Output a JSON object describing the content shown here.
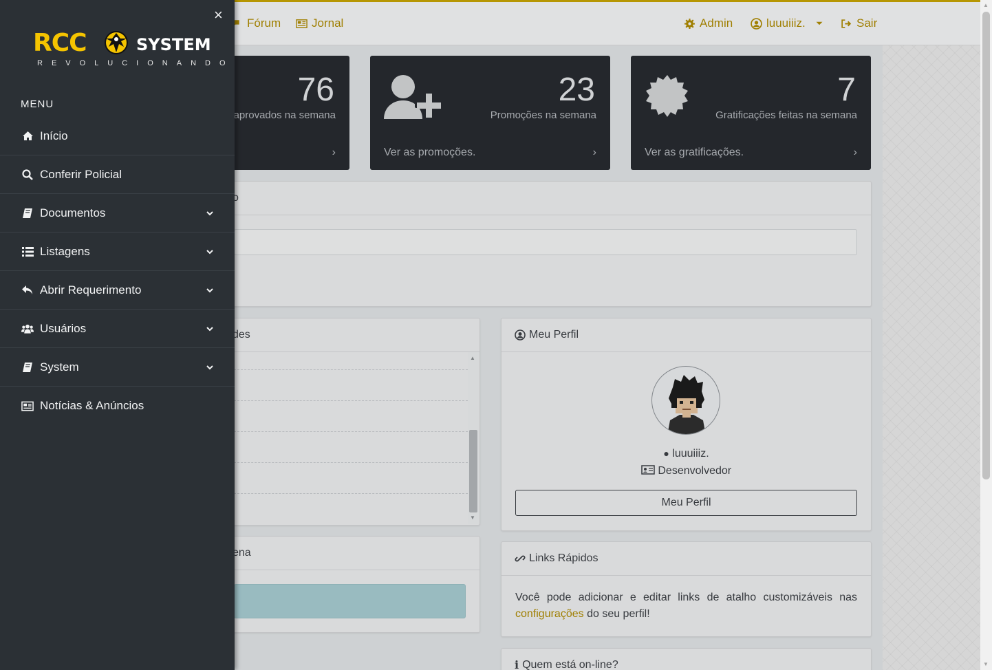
{
  "topbar": {
    "forum_label": "Fórum",
    "jornal_label": "Jornal",
    "admin_label": "Admin",
    "user_label": "luuuiiiz.",
    "logout_label": "Sair"
  },
  "stats": [
    {
      "number": "76",
      "caption": "aprovados na semana"
    },
    {
      "number": "23",
      "caption": "Promoções na semana",
      "link": "Ver as promoções."
    },
    {
      "number": "7",
      "caption": "Gratificações feitas na semana",
      "link": "Ver as gratificações."
    }
  ],
  "panels": {
    "search_panel_fragment": "o",
    "activities_fragment": "des",
    "week_fragment": "ena"
  },
  "profile": {
    "title": "Meu Perfil",
    "username": "luuuiiiz.",
    "role": "Desenvolvedor",
    "button_label": "Meu Perfil"
  },
  "quick_links": {
    "title": "Links Rápidos",
    "text_before": "Você pode adicionar e editar links de atalho customizáveis nas ",
    "link_text": "configurações",
    "text_after": " do seu perfil!"
  },
  "online": {
    "title": "Quem está on-line?"
  },
  "sidebar": {
    "close_label": "×",
    "logo_main": "RCC",
    "logo_system": "SYSTEM",
    "logo_tagline": "REVOLUCIONANDO",
    "menu_title": "MENU",
    "items": [
      {
        "label": "Início",
        "icon": "home-icon"
      },
      {
        "label": "Conferir Policial",
        "icon": "search-icon"
      },
      {
        "label": "Documentos",
        "icon": "book-icon"
      },
      {
        "label": "Listagens",
        "icon": "list-icon"
      },
      {
        "label": "Abrir Requerimento",
        "icon": "reply-icon"
      },
      {
        "label": "Usuários",
        "icon": "users-icon"
      },
      {
        "label": "System",
        "icon": "book-icon"
      },
      {
        "label": "Notícias & Anúncios",
        "icon": "newspaper-icon"
      }
    ]
  },
  "colors": {
    "accent": "#c9a500",
    "sidebar_bg": "#2b3035",
    "card_bg": "#262a2f"
  }
}
